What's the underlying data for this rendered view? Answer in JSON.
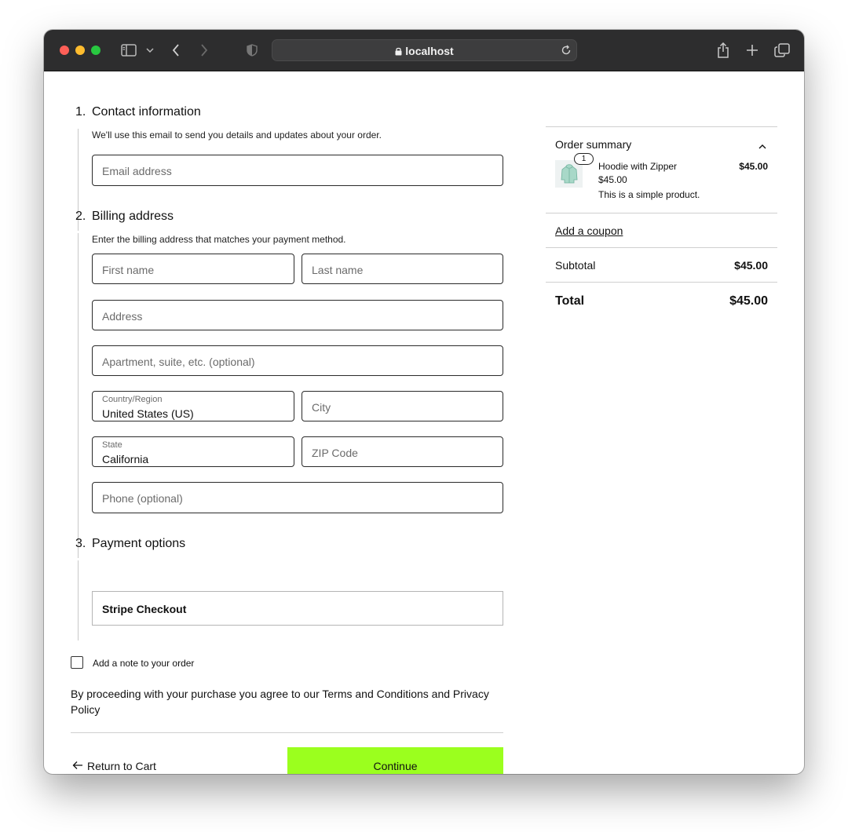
{
  "browser": {
    "url": "localhost"
  },
  "checkout": {
    "contact": {
      "number": "1.",
      "title": "Contact information",
      "description": "We'll use this email to send you details and updates about your order.",
      "email_placeholder": "Email address"
    },
    "billing": {
      "number": "2.",
      "title": "Billing address",
      "description": "Enter the billing address that matches your payment method.",
      "first_name_placeholder": "First name",
      "last_name_placeholder": "Last name",
      "address_placeholder": "Address",
      "apartment_placeholder": "Apartment, suite, etc. (optional)",
      "country_label": "Country/Region",
      "country_value": "United States (US)",
      "city_placeholder": "City",
      "state_label": "State",
      "state_value": "California",
      "zip_placeholder": "ZIP Code",
      "phone_placeholder": "Phone (optional)"
    },
    "payment": {
      "number": "3.",
      "title": "Payment options",
      "method": "Stripe Checkout"
    },
    "note_label": "Add a note to your order",
    "terms_text": "By proceeding with your purchase you agree to our Terms and Conditions and Privacy Policy",
    "return_label": "Return to Cart",
    "continue_label": "Continue",
    "continue_color": "#9bff1e"
  },
  "summary": {
    "title": "Order summary",
    "items": [
      {
        "quantity": "1",
        "name": "Hoodie with Zipper",
        "unit_price": "$45.00",
        "description": "This is a simple product.",
        "line_total": "$45.00"
      }
    ],
    "coupon_label": "Add a coupon",
    "subtotal_label": "Subtotal",
    "subtotal_value": "$45.00",
    "total_label": "Total",
    "total_value": "$45.00"
  }
}
